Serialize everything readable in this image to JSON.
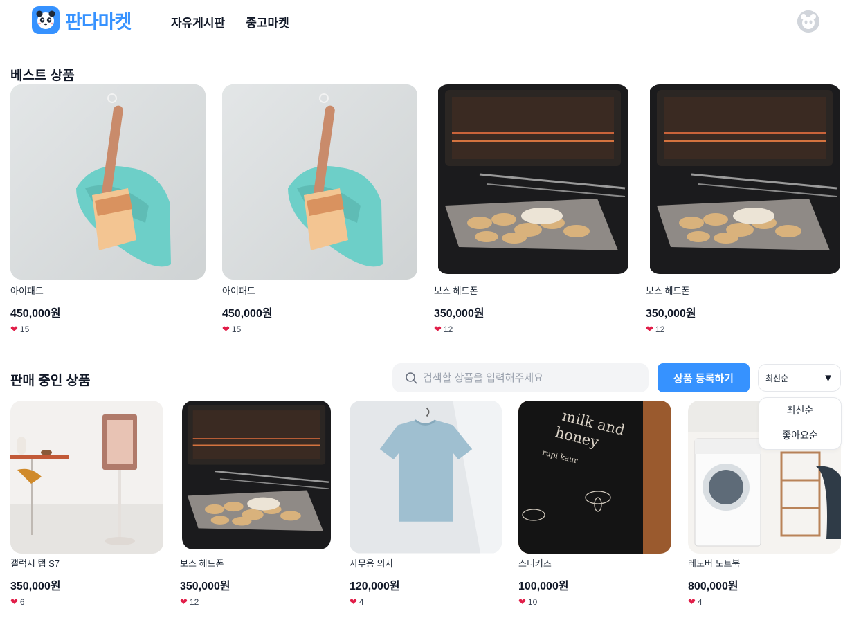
{
  "header": {
    "logo_text": "판다마켓",
    "nav": [
      "자유게시판",
      "중고마켓"
    ]
  },
  "best": {
    "title": "베스트 상품",
    "items": [
      {
        "name": "아이패드",
        "price": "450,000원",
        "likes": "15",
        "image": "dustpan"
      },
      {
        "name": "아이패드",
        "price": "450,000원",
        "likes": "15",
        "image": "dustpan"
      },
      {
        "name": "보스 헤드폰",
        "price": "350,000원",
        "likes": "12",
        "image": "oven"
      },
      {
        "name": "보스 헤드폰",
        "price": "350,000원",
        "likes": "12",
        "image": "oven"
      }
    ]
  },
  "selling": {
    "title": "판매 중인 상품",
    "search_placeholder": "검색할 상품을 입력해주세요",
    "register_label": "상품 등록하기",
    "sort_selected": "최신순",
    "sort_options": [
      "최신순",
      "좋아요순"
    ],
    "items": [
      {
        "name": "갤럭시 탭 S7",
        "price": "350,000원",
        "likes": "6",
        "image": "stand-display"
      },
      {
        "name": "보스 헤드폰",
        "price": "350,000원",
        "likes": "12",
        "image": "oven"
      },
      {
        "name": "사무용 의자",
        "price": "120,000원",
        "likes": "4",
        "image": "t-shirt"
      },
      {
        "name": "스니커즈",
        "price": "100,000원",
        "likes": "10",
        "image": "book"
      },
      {
        "name": "레노버 노트북",
        "price": "800,000원",
        "likes": "4",
        "image": "washing-machine"
      }
    ],
    "book_cover": {
      "title_line1": "milk and",
      "title_line2": "honey",
      "author": "rupi kaur"
    }
  },
  "colors": {
    "brand": "#3692ff",
    "heart": "#e11d48"
  }
}
